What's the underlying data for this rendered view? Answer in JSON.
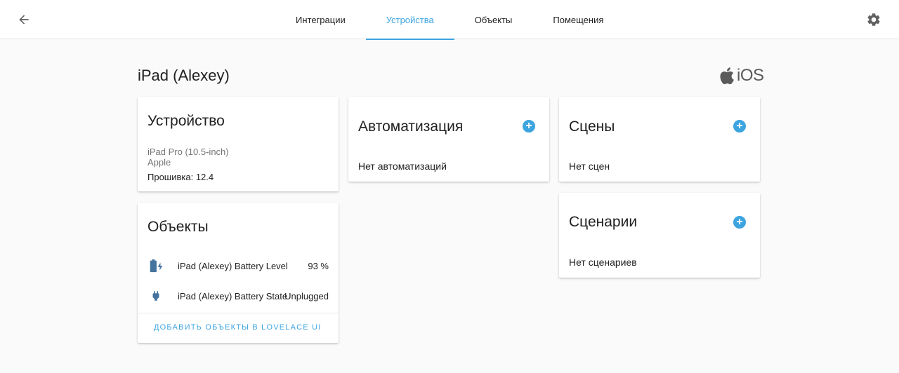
{
  "header": {
    "back_icon": "arrow-left-icon",
    "settings_icon": "gear-icon",
    "tabs": [
      {
        "label": "Интеграции",
        "active": false
      },
      {
        "label": "Устройства",
        "active": true
      },
      {
        "label": "Объекты",
        "active": false
      },
      {
        "label": "Помещения",
        "active": false
      }
    ]
  },
  "page": {
    "title": "iPad (Alexey)",
    "brand_text": "iOS",
    "brand_icon": "apple-icon"
  },
  "device_card": {
    "title": "Устройство",
    "model": "iPad Pro (10.5-inch)",
    "manufacturer": "Apple",
    "firmware": "Прошивка: 12.4"
  },
  "entities_card": {
    "title": "Объекты",
    "rows": [
      {
        "icon": "battery-charging-icon",
        "name": "iPad (Alexey) Battery Level",
        "value": "93 %"
      },
      {
        "icon": "power-plug-icon",
        "name": "iPad (Alexey) Battery State",
        "value": "Unplugged"
      }
    ],
    "action_label": "ДОБАВИТЬ ОБЪЕКТЫ В LOVELACE UI"
  },
  "automation_card": {
    "title": "Автоматизация",
    "empty_text": "Нет автоматизаций"
  },
  "scenes_card": {
    "title": "Сцены",
    "empty_text": "Нет сцен"
  },
  "scripts_card": {
    "title": "Сценарии",
    "empty_text": "Нет сценариев"
  },
  "colors": {
    "accent": "#3da4e0",
    "icon": "#44739e"
  }
}
